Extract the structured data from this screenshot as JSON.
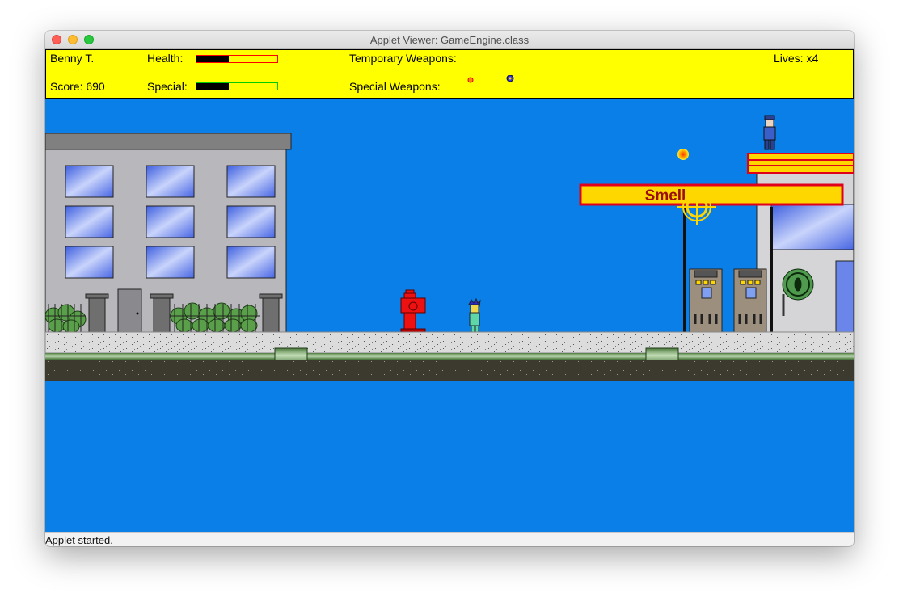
{
  "window": {
    "title": "Applet Viewer: GameEngine.class"
  },
  "hud": {
    "player_name": "Benny T.",
    "health_label": "Health:",
    "health_level": 0.4,
    "health_color": "#ff0000",
    "temporary_weapons_label": "Temporary Weapons:",
    "lives_label": "Lives: x4",
    "score_label": "Score: 690",
    "special_label": "Special:",
    "special_level": 0.4,
    "special_color": "#00cc00",
    "special_weapons_label": "Special Weapons:"
  },
  "scene": {
    "sky_color": "#0a7fe8",
    "gas_station_sign": "Smell"
  },
  "status": {
    "text": "Applet started."
  }
}
